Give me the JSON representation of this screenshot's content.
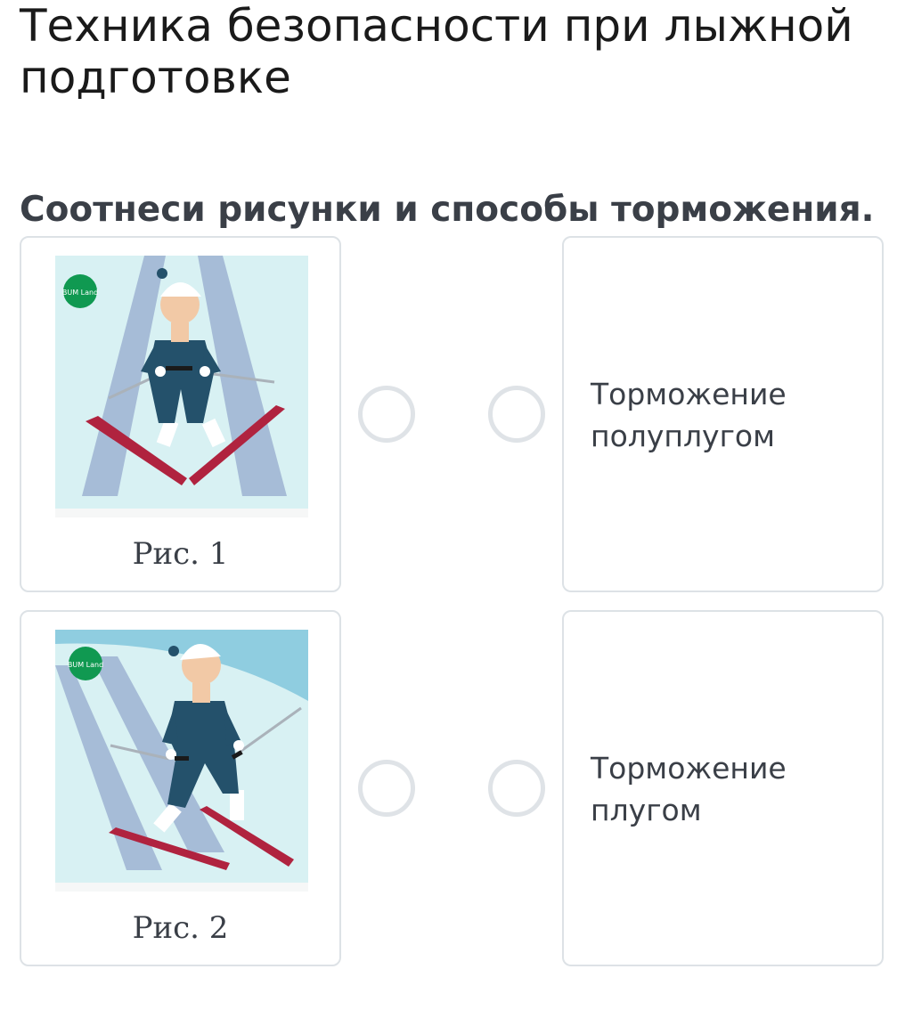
{
  "page": {
    "title": "Техника безопасности при лыжной подготовке",
    "prompt": "Соотнеси рисунки и способы торможения."
  },
  "pairs": [
    {
      "image_caption": "Рис. 1",
      "image_logo_text": "BUM Land",
      "answer_label": "Торможение полуплугом"
    },
    {
      "image_caption": "Рис. 2",
      "image_logo_text": "BUM Land",
      "answer_label": "Торможение плугом"
    }
  ],
  "colors": {
    "card_border": "#dde2e6",
    "radio_border": "#dfe3e7",
    "prompt_text": "#3a3f47",
    "illustration_bg": "#d8f1f3",
    "ski_color": "#b0233f",
    "suit_color": "#24516b",
    "logo_green": "#109951"
  }
}
